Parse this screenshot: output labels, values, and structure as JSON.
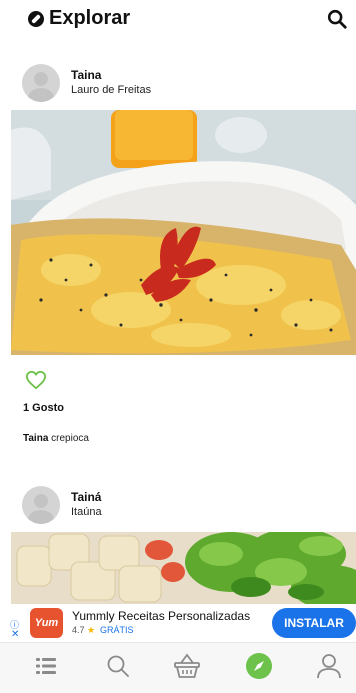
{
  "header": {
    "title": "Explorar",
    "logo_icon": "compass-icon",
    "search_icon": "search-icon"
  },
  "posts": [
    {
      "user": "Taina",
      "location": "Lauro de Freitas",
      "likes": "1 Gosto",
      "caption_user": "Taina",
      "caption_text": " crepioca"
    },
    {
      "user": "Tainá",
      "location": "Itaúna"
    }
  ],
  "ad": {
    "app_name": "Yummly Receitas Personalizadas",
    "logo_text": "Yum",
    "rating": "4.7",
    "price": "GRÁTIS",
    "install_label": "INSTALAR",
    "accent": "#1a73e8"
  },
  "nav": {
    "items": [
      "list-icon",
      "search-icon",
      "basket-icon",
      "compass-icon",
      "profile-icon"
    ],
    "active": "compass-icon",
    "active_color": "#6cc24a"
  }
}
